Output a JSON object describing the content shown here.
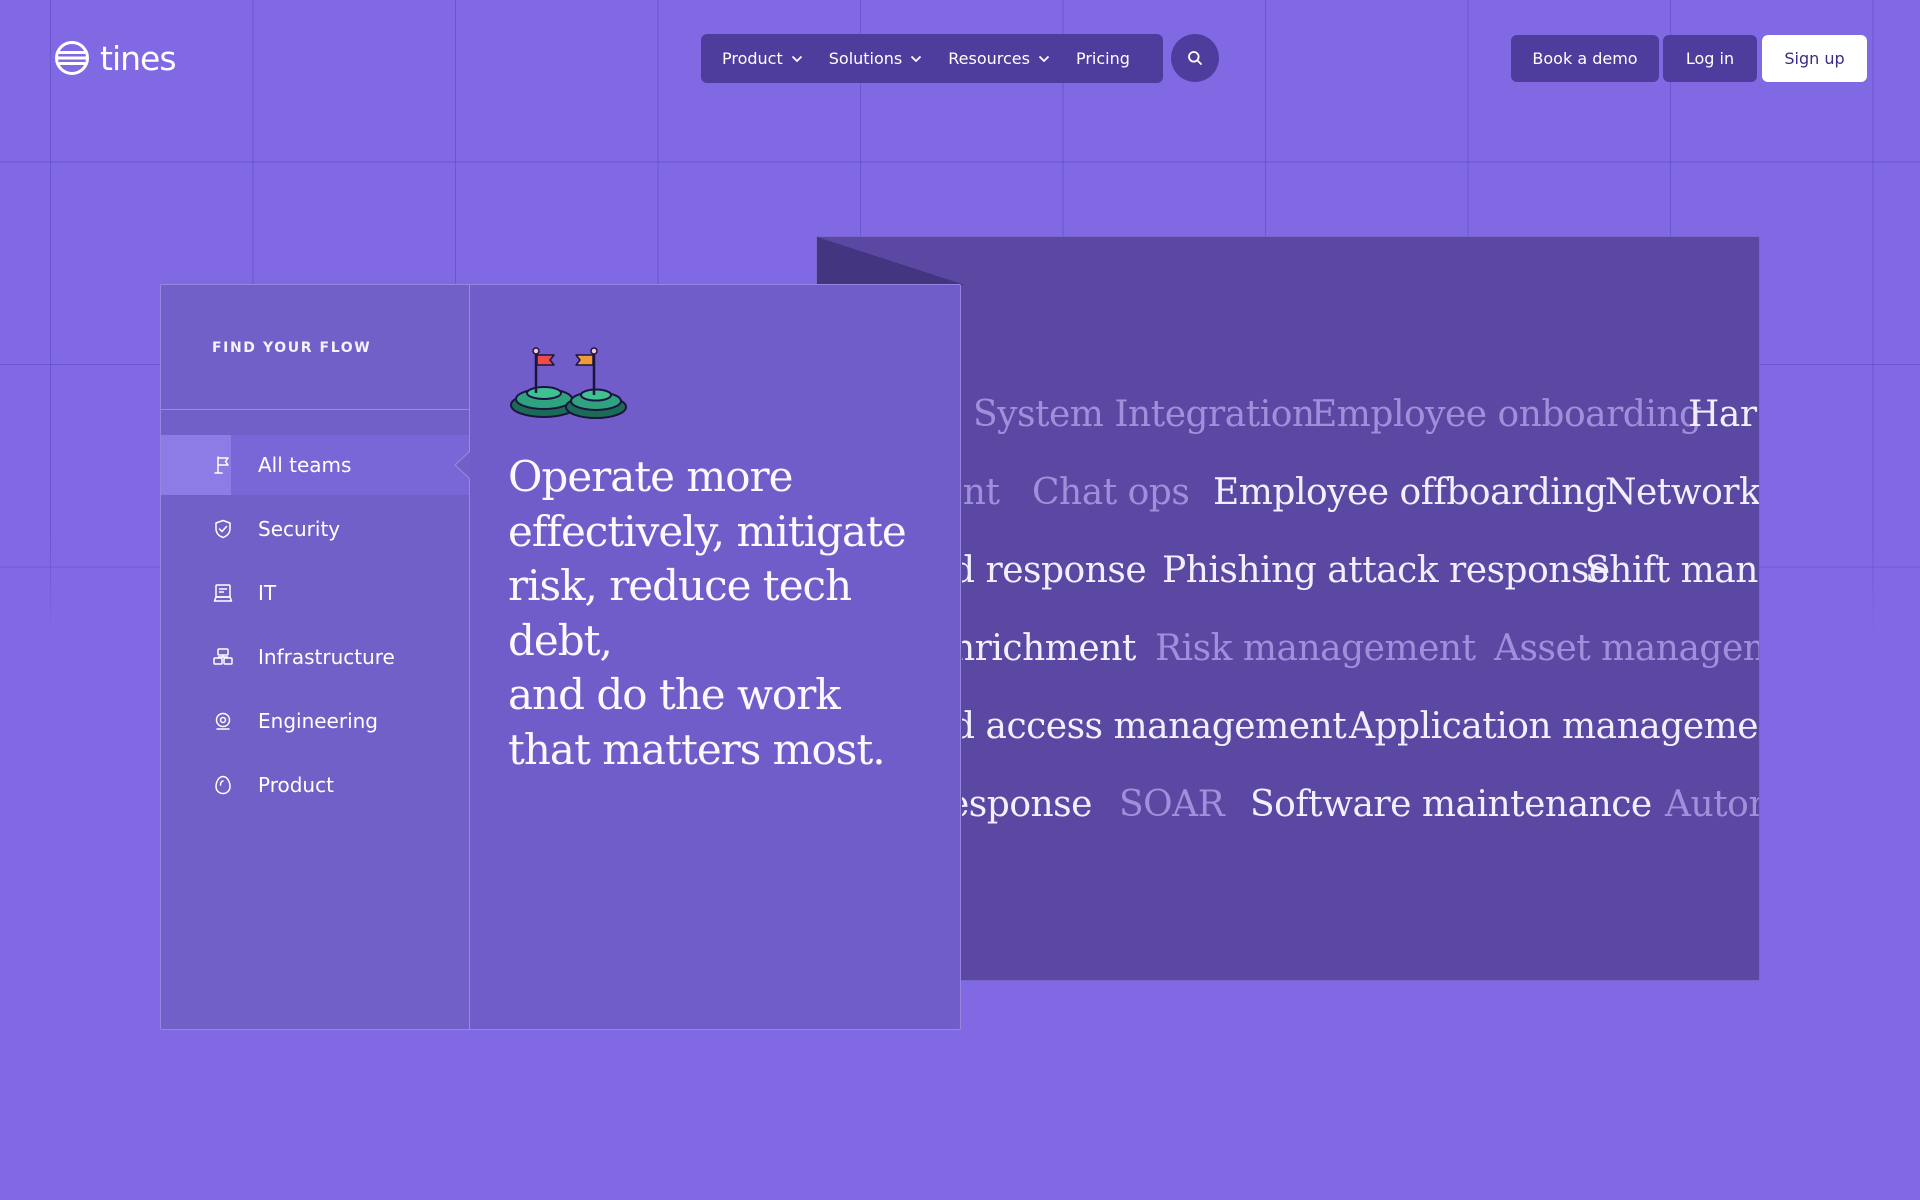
{
  "brand": {
    "name": "tines"
  },
  "nav": {
    "items": [
      {
        "label": "Product",
        "dropdown": true
      },
      {
        "label": "Solutions",
        "dropdown": true
      },
      {
        "label": "Resources",
        "dropdown": true
      },
      {
        "label": "Pricing",
        "dropdown": false
      }
    ],
    "search_icon": "search-icon"
  },
  "header_actions": {
    "book_demo": "Book a demo",
    "login": "Log in",
    "signup": "Sign up"
  },
  "flow": {
    "title": "FIND YOUR FLOW",
    "teams": [
      {
        "label": "All teams",
        "icon": "flag-icon",
        "active": true
      },
      {
        "label": "Security",
        "icon": "shield-icon",
        "active": false
      },
      {
        "label": "IT",
        "icon": "laptop-icon",
        "active": false
      },
      {
        "label": "Infrastructure",
        "icon": "server-icon",
        "active": false
      },
      {
        "label": "Engineering",
        "icon": "gear-icon",
        "active": false
      },
      {
        "label": "Product",
        "icon": "egg-icon",
        "active": false
      }
    ],
    "headline": [
      "Operate more",
      "effectively, mitigate",
      "risk, reduce tech debt,",
      "and do the work",
      "that matters most."
    ]
  },
  "use_case_rows": [
    [
      {
        "text": "System Integration",
        "bright": false
      },
      {
        "text": "Employee onboarding",
        "bright": false
      },
      {
        "text": "Har",
        "bright": true
      }
    ],
    [
      {
        "text": "ent",
        "bright": false
      },
      {
        "text": "Chat ops",
        "bright": false
      },
      {
        "text": "Employee offboarding",
        "bright": true
      },
      {
        "text": "Network s",
        "bright": true
      }
    ],
    [
      {
        "text": "d response",
        "bright": true
      },
      {
        "text": "Phishing attack response",
        "bright": true
      },
      {
        "text": "Shift mana",
        "bright": true
      }
    ],
    [
      {
        "text": "nrichment",
        "bright": true
      },
      {
        "text": "Risk management",
        "bright": false
      },
      {
        "text": "Asset manageme",
        "bright": false
      }
    ],
    [
      {
        "text": "d access management",
        "bright": true
      },
      {
        "text": "Application management",
        "bright": true
      }
    ],
    [
      {
        "text": "esponse",
        "bright": true
      },
      {
        "text": "SOAR",
        "bright": false
      },
      {
        "text": "Software maintenance",
        "bright": true
      },
      {
        "text": "Autom",
        "bright": false
      }
    ]
  ],
  "colors": {
    "background": "#8069e2",
    "nav_bg": "#4f3d9d",
    "panel_bg": "#5b48a2",
    "card_bg": "#705dc9",
    "signup_text": "#3a2b85"
  }
}
